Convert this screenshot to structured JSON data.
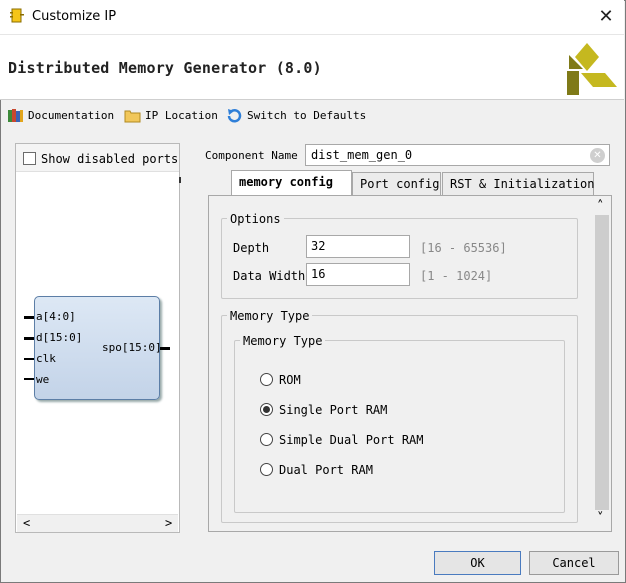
{
  "window": {
    "title": "Customize IP",
    "close_glyph": "✕"
  },
  "header": {
    "title": "Distributed Memory Generator (8.0)"
  },
  "toolbar": {
    "documentation": "Documentation",
    "ip_location": "IP Location",
    "switch_defaults": "Switch to Defaults"
  },
  "left": {
    "show_disabled_ports": "Show disabled ports",
    "ports_in": [
      "a[4:0]",
      "d[15:0]",
      "clk",
      "we"
    ],
    "port_out": "spo[15:0]",
    "scroll_left": "<",
    "scroll_right": ">"
  },
  "component": {
    "label": "Component Name",
    "value": "dist_mem_gen_0",
    "clear_glyph": "✕"
  },
  "tabs": [
    {
      "label": "memory config",
      "active": true
    },
    {
      "label": "Port config",
      "active": false
    },
    {
      "label": "RST & Initialization",
      "active": false
    }
  ],
  "options": {
    "title": "Options",
    "depth_label": "Depth",
    "depth_value": "32",
    "depth_range": "[16 - 65536]",
    "width_label": "Data Width",
    "width_value": "16",
    "width_range": "[1 - 1024]"
  },
  "memory_type": {
    "outer_title": "Memory Type",
    "inner_title": "Memory Type",
    "options": [
      "ROM",
      "Single Port RAM",
      "Simple Dual Port RAM",
      "Dual Port RAM"
    ],
    "selected": "Single Port RAM"
  },
  "scroll": {
    "up": "˄",
    "down": "˅"
  },
  "buttons": {
    "ok": "OK",
    "cancel": "Cancel"
  },
  "colors": {
    "accent_blue": "#4a7bbf",
    "logo_yellow": "#c5b81f",
    "logo_dark": "#7f7a18"
  }
}
